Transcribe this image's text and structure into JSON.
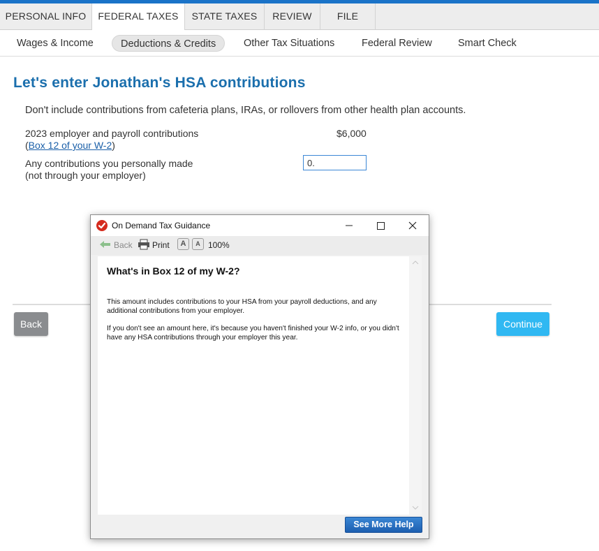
{
  "main_tabs": [
    {
      "label": "PERSONAL INFO",
      "active": false
    },
    {
      "label": "FEDERAL TAXES",
      "active": true
    },
    {
      "label": "STATE TAXES",
      "active": false
    },
    {
      "label": "REVIEW",
      "active": false
    },
    {
      "label": "FILE",
      "active": false
    }
  ],
  "sub_tabs": [
    {
      "label": "Wages & Income",
      "active": false
    },
    {
      "label": "Deductions & Credits",
      "active": true
    },
    {
      "label": "Other Tax Situations",
      "active": false
    },
    {
      "label": "Federal Review",
      "active": false
    },
    {
      "label": "Smart Check",
      "active": false
    }
  ],
  "page": {
    "title": "Let's enter Jonathan's HSA contributions",
    "intro": "Don't include contributions from cafeteria plans, IRAs, or rollovers from other health plan accounts.",
    "employer_label_line1": "2023 employer and payroll contributions",
    "employer_label_open": "(",
    "employer_link": "Box 12 of your W-2",
    "employer_label_close": ")",
    "employer_amount": "$6,000",
    "personal_label_line1": "Any contributions you personally made",
    "personal_label_line2": "(not through your employer)",
    "personal_value": "0."
  },
  "buttons": {
    "back": "Back",
    "continue": "Continue"
  },
  "dialog": {
    "title": "On Demand Tax Guidance",
    "toolbar_back": "Back",
    "toolbar_print": "Print",
    "font_small": "A",
    "font_large": "A",
    "zoom": "100%",
    "heading": "What's in Box 12 of my W-2?",
    "para1": "This amount includes contributions to your HSA from your payroll deductions, and any additional contributions from your employer.",
    "para2": "If you don't see an amount here, it's because you haven't finished your W-2 info, or you didn't have any HSA contributions through your employer this year.",
    "see_more": "See More Help"
  },
  "colors": {
    "brand_blue": "#1a73c8",
    "title_blue": "#1b6fad",
    "continue_blue": "#30b8f2",
    "back_gray": "#8a8c8f",
    "logo_red": "#d52b1e"
  }
}
